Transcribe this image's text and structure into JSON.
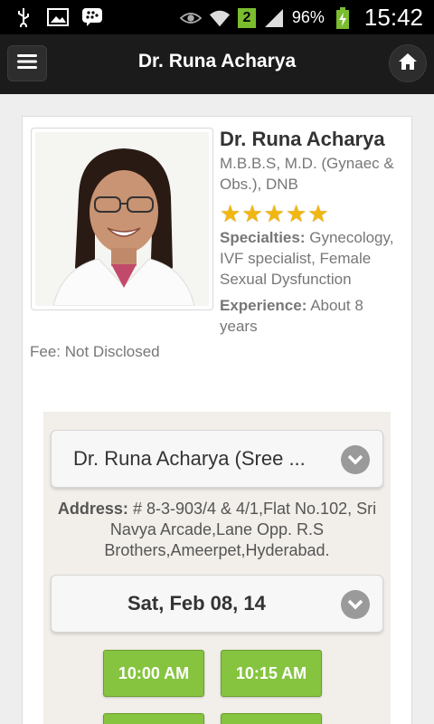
{
  "status_bar": {
    "notification_count": "2",
    "battery": "96%",
    "time": "15:42"
  },
  "header": {
    "title": "Dr. Runa Acharya"
  },
  "profile": {
    "name": "Dr. Runa Acharya",
    "degrees": "M.B.B.S, M.D. (Gynaec & Obs.), DNB",
    "rating": 5,
    "specialties_label": "Specialties:",
    "specialties": "Gynecology, IVF specialist, Female Sexual Dysfunction",
    "experience_label": "Experience:",
    "experience": "About 8 years",
    "fee": "Fee: Not Disclosed"
  },
  "booking": {
    "clinic_select": "Dr. Runa Acharya (Sree ...",
    "address_label": "Address:",
    "address": "# 8-3-903/4 & 4/1,Flat No.102, Sri Navya Arcade,Lane Opp. R.S Brothers,Ameerpet,Hyderabad.",
    "date_select": "Sat, Feb 08, 14",
    "time_slots": [
      "10:00 AM",
      "10:15 AM"
    ]
  },
  "colors": {
    "accent_green": "#86c440",
    "star": "#f2b70f"
  }
}
